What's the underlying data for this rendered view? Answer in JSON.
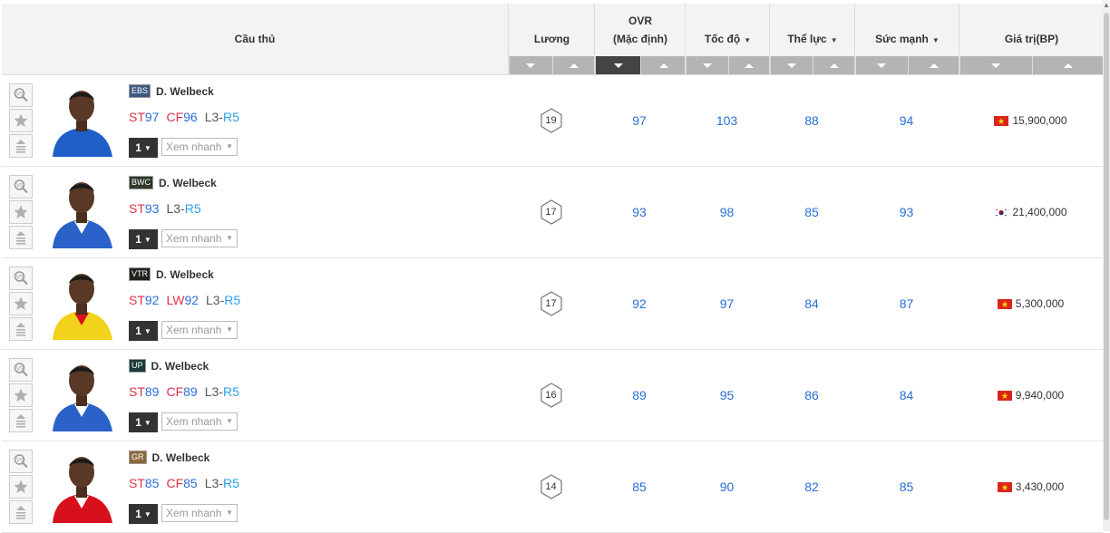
{
  "headers": {
    "player": "Cầu thủ",
    "salary": "Lương",
    "ovr": "OVR",
    "ovr_sub": "(Mặc định)",
    "speed": "Tốc độ",
    "stamina": "Thể lực",
    "strength": "Sức mạnh",
    "value": "Giá trị(BP)"
  },
  "quick_view_label": "Xem nhanh",
  "colors": {
    "header_bg": "#f3f3f3",
    "sort_bg": "#b4b4b4",
    "sort_active": "#444444",
    "stat_blue": "#2a6fd6",
    "position_red": "#e0304a",
    "level_cyan": "#2aa0e8"
  },
  "players": [
    {
      "season": "EBS",
      "season_color": "#3b5a82",
      "name": "D. Welbeck",
      "positions": [
        {
          "pos": "ST",
          "val": "97"
        },
        {
          "pos": "CF",
          "val": "96"
        }
      ],
      "level_left": "L3",
      "level_sep": "-",
      "level_right": "R5",
      "level": "1",
      "salary": "19",
      "ovr": "97",
      "speed": "103",
      "stamina": "88",
      "strength": "94",
      "flag": "vn-flag",
      "price": "15,900,000",
      "kit": "#1f5fc8",
      "kit2": "#1f5fc8"
    },
    {
      "season": "BWC",
      "season_color": "#2f3a2a",
      "name": "D. Welbeck",
      "positions": [
        {
          "pos": "ST",
          "val": "93"
        }
      ],
      "level_left": "L3",
      "level_sep": "-",
      "level_right": "R5",
      "level": "1",
      "salary": "17",
      "ovr": "93",
      "speed": "98",
      "stamina": "85",
      "strength": "93",
      "flag": "kr-flag",
      "price": "21,400,000",
      "kit": "#2a62c9",
      "kit2": "#ffffff"
    },
    {
      "season": "VTR",
      "season_color": "#20241c",
      "name": "D. Welbeck",
      "positions": [
        {
          "pos": "ST",
          "val": "92"
        },
        {
          "pos": "LW",
          "val": "92"
        }
      ],
      "level_left": "L3",
      "level_sep": "-",
      "level_right": "R5",
      "level": "1",
      "salary": "17",
      "ovr": "92",
      "speed": "97",
      "stamina": "84",
      "strength": "87",
      "flag": "vn-flag",
      "price": "5,300,000",
      "kit": "#f2d21b",
      "kit2": "#d8101c"
    },
    {
      "season": "UP",
      "season_color": "#1d3a3a",
      "name": "D. Welbeck",
      "positions": [
        {
          "pos": "ST",
          "val": "89"
        },
        {
          "pos": "CF",
          "val": "89"
        }
      ],
      "level_left": "L3",
      "level_sep": "-",
      "level_right": "R5",
      "level": "1",
      "salary": "16",
      "ovr": "89",
      "speed": "95",
      "stamina": "86",
      "strength": "84",
      "flag": "vn-flag",
      "price": "9,940,000",
      "kit": "#2a62c9",
      "kit2": "#ffffff"
    },
    {
      "season": "GR",
      "season_color": "#8a6a3a",
      "name": "D. Welbeck",
      "positions": [
        {
          "pos": "ST",
          "val": "85"
        },
        {
          "pos": "CF",
          "val": "85"
        }
      ],
      "level_left": "L3",
      "level_sep": "-",
      "level_right": "R5",
      "level": "1",
      "salary": "14",
      "ovr": "85",
      "speed": "90",
      "stamina": "82",
      "strength": "85",
      "flag": "vn-flag",
      "price": "3,430,000",
      "kit": "#d8101c",
      "kit2": "#ffffff"
    }
  ]
}
